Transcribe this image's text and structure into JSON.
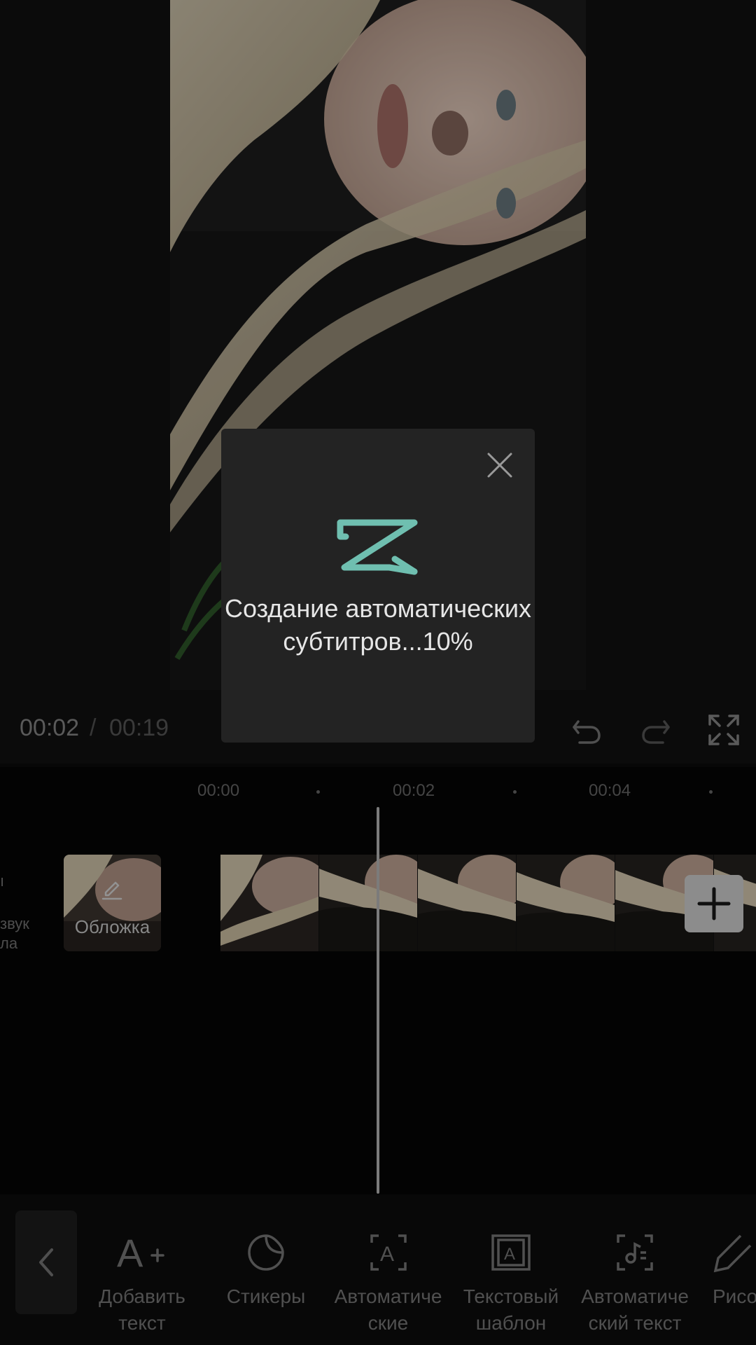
{
  "player": {
    "time_current": "00:02",
    "time_separator": "/",
    "time_total": "00:19",
    "controls": [
      "undo-icon",
      "redo-icon",
      "fullscreen-icon"
    ]
  },
  "timeline": {
    "ticks": [
      "00:00",
      "00:02",
      "00:04"
    ],
    "side_label_1": "ı",
    "side_label_2": "звук\nла",
    "cover_label": "Обложка",
    "add_clip_icon": "plus-icon"
  },
  "modal": {
    "logo_icon": "capcut-logo-icon",
    "close_icon": "close-icon",
    "message": "Создание автоматических субтитров...10%",
    "progress_percent": 10,
    "accent_color": "#6fbfb0"
  },
  "toolbar": {
    "back_icon": "chevron-left-icon",
    "items": [
      {
        "label": "Добавить\nтекст",
        "icon": "add-text-icon"
      },
      {
        "label": "Стикеры",
        "icon": "sticker-icon"
      },
      {
        "label": "Автоматиче\nские",
        "icon": "auto-captions-icon"
      },
      {
        "label": "Текстовый\nшаблон",
        "icon": "text-template-icon"
      },
      {
        "label": "Автоматиче\nский текст",
        "icon": "auto-lyrics-icon"
      },
      {
        "label": "Рисо",
        "icon": "draw-icon"
      }
    ]
  }
}
